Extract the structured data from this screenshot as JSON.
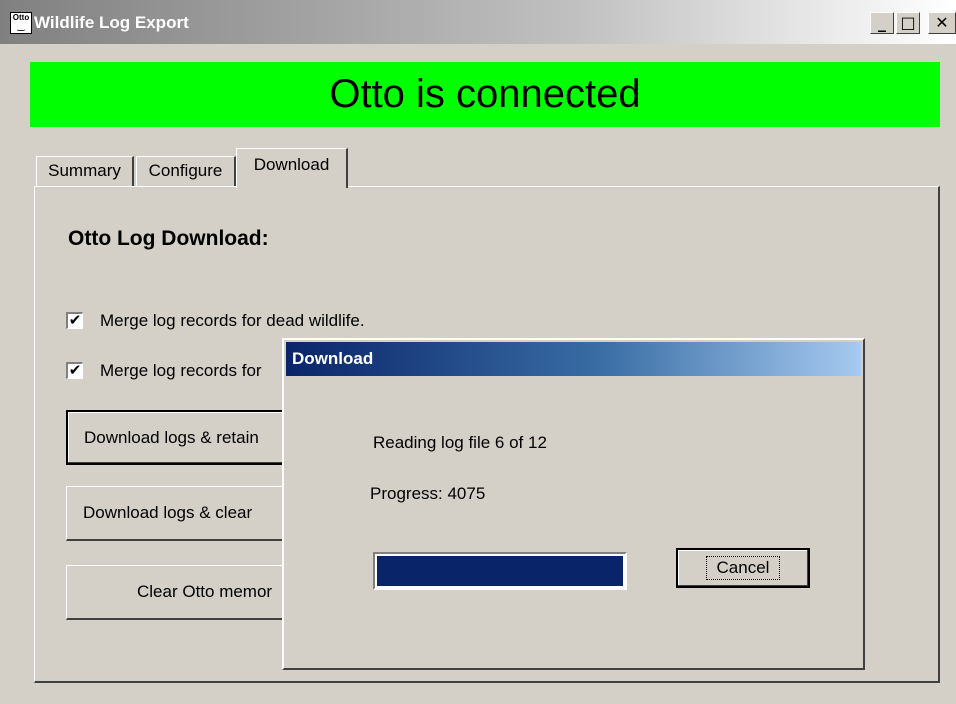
{
  "window": {
    "icon_label": "Otto",
    "title": "Wildlife Log Export",
    "minimize_glyph": "_",
    "maximize_glyph": "□",
    "close_glyph": "✕"
  },
  "status": {
    "text": "Otto is connected",
    "color": "#00ff00"
  },
  "tabs": [
    {
      "label": "Summary",
      "active": false
    },
    {
      "label": "Configure",
      "active": false
    },
    {
      "label": "Download",
      "active": true
    }
  ],
  "download_panel": {
    "heading": "Otto Log Download:",
    "checkboxes": [
      {
        "label": "Merge log records for dead wildlife.",
        "checked": true,
        "mark": "✔"
      },
      {
        "label": "Merge log records for",
        "checked": true,
        "mark": "✔"
      }
    ],
    "buttons": {
      "retain": "Download logs & retain",
      "clear": "Download logs & clear",
      "clear_memory": "Clear Otto memor"
    }
  },
  "dialog": {
    "title": "Download",
    "reading_text": "Reading log file 6 of 12",
    "progress_text": "Progress: 4075",
    "progress_fraction": 1.0,
    "cancel_label": "Cancel"
  }
}
